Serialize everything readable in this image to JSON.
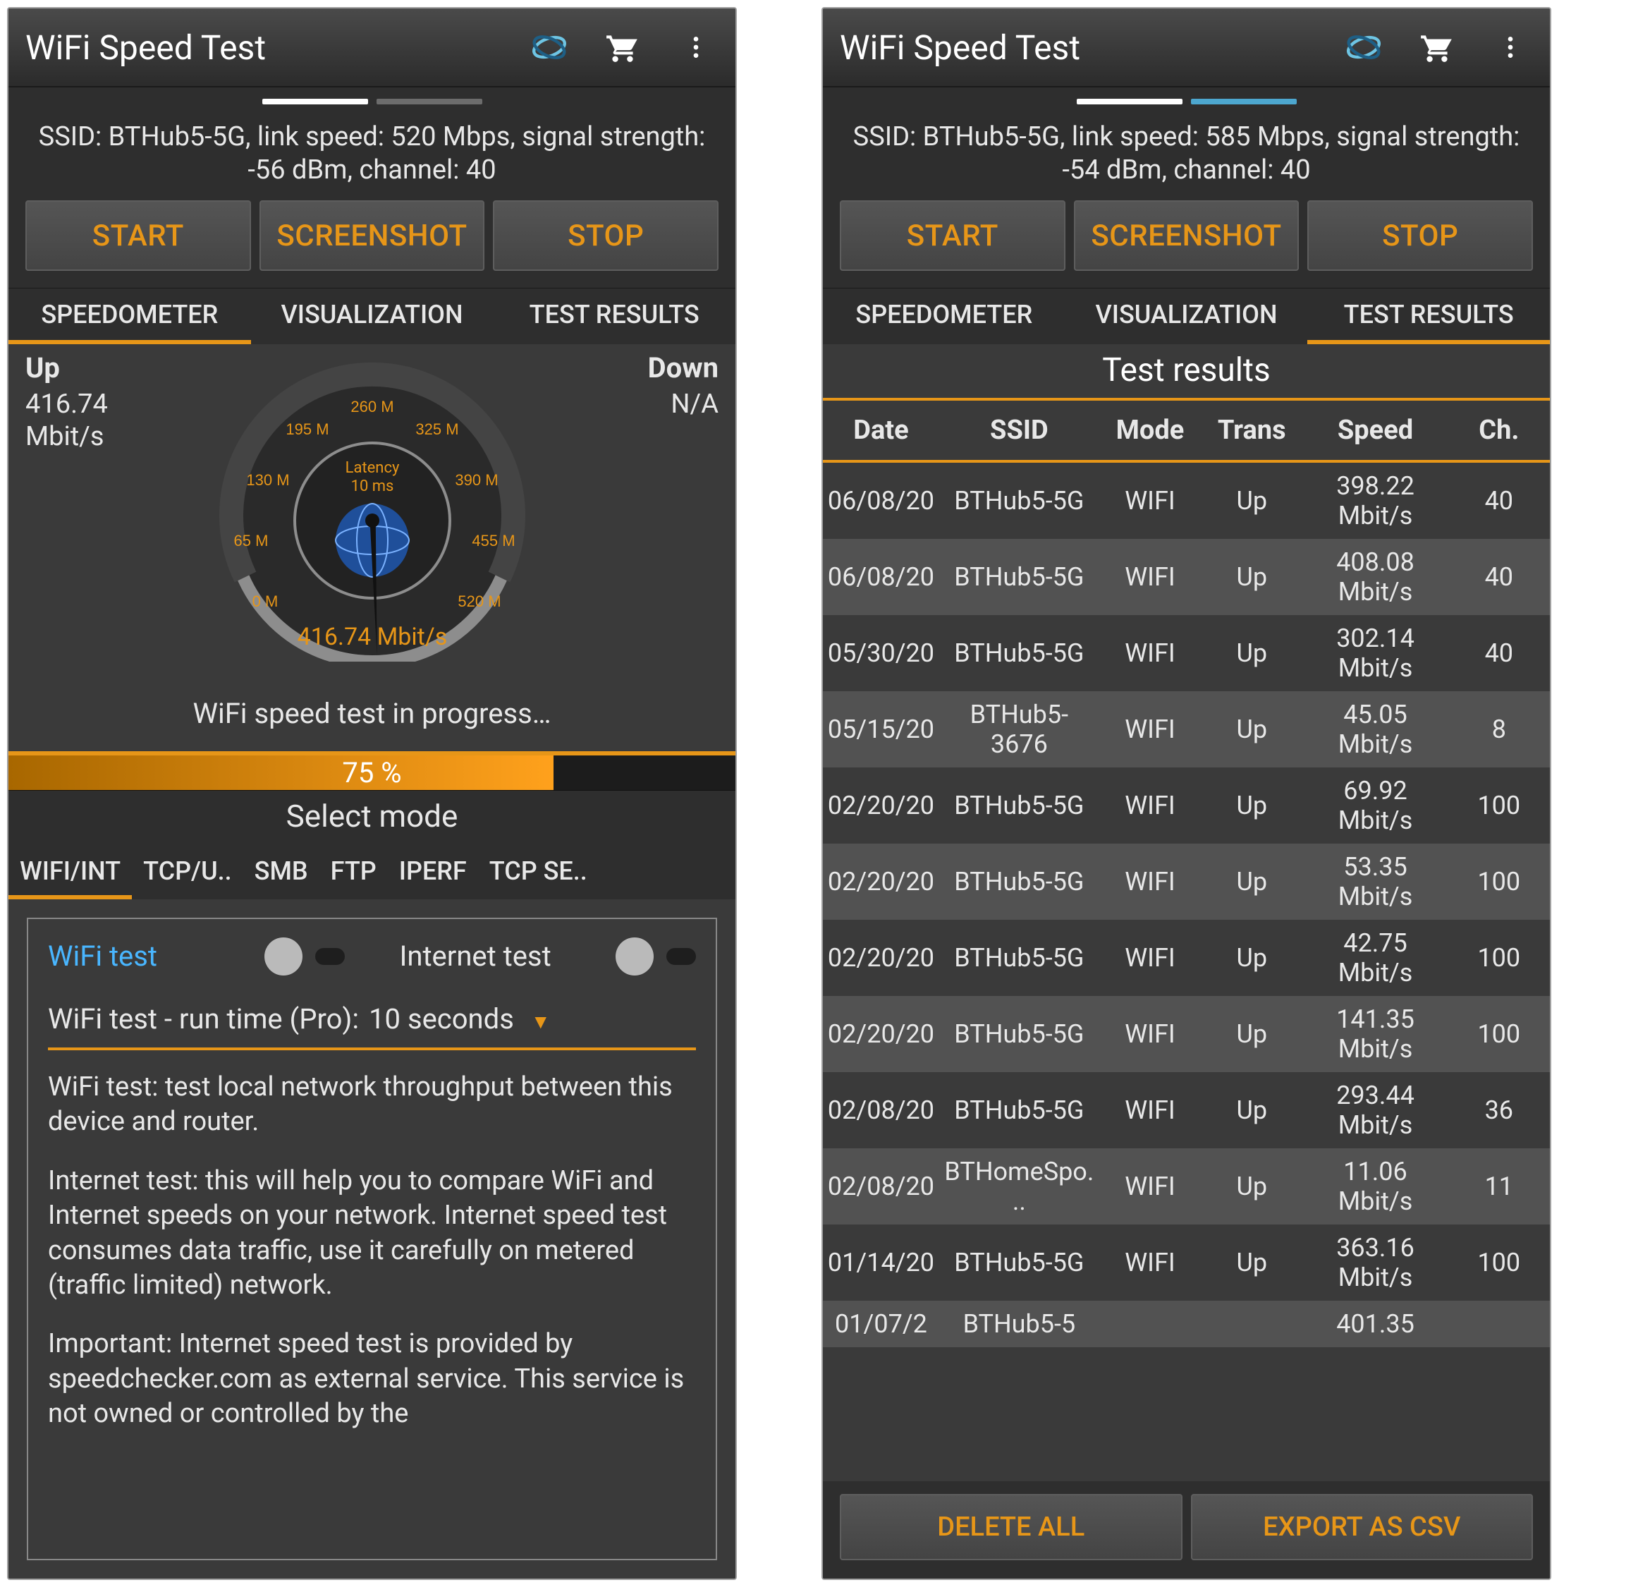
{
  "left": {
    "appbar": {
      "title": "WiFi Speed Test"
    },
    "ssid_line": "SSID: BTHub5-5G, link speed: 520 Mbps, signal strength: -56 dBm, channel: 40",
    "buttons": {
      "start": "START",
      "screenshot": "SCREENSHOT",
      "stop": "STOP"
    },
    "tabs": [
      "SPEEDOMETER",
      "VISUALIZATION",
      "TEST RESULTS"
    ],
    "active_tab": 0,
    "upload": {
      "label": "Up",
      "value": "416.74",
      "unit": "Mbit/s"
    },
    "download": {
      "label": "Down",
      "value": "N/A",
      "unit": ""
    },
    "gauge": {
      "latency_label": "Latency",
      "latency_value": "10 ms",
      "reading": "416.74 Mbit/s",
      "ticks": [
        "0 M",
        "65 M",
        "130 M",
        "195 M",
        "260 M",
        "325 M",
        "390 M",
        "455 M",
        "520 M"
      ]
    },
    "status_msg": "WiFi speed test in progress…",
    "progress_pct": "75 %",
    "select_mode": "Select mode",
    "subtabs": [
      "WIFI/INT",
      "TCP/U..",
      "SMB",
      "FTP",
      "IPERF",
      "TCP SE.."
    ],
    "active_subtab": 0,
    "wifi_panel": {
      "wifi_label": "WiFi test",
      "internet_label": "Internet test",
      "runtime_label": "WiFi test - run time (Pro):",
      "runtime_value": "10 seconds",
      "para1": "WiFi test: test local network throughput between this device and router.",
      "para2": "Internet test: this will help you to compare WiFi and Internet speeds on your network. Internet speed test consumes data traffic, use it carefully on metered (traffic limited) network.",
      "para3": "Important: Internet speed test is provided by speedchecker.com as external service. This service is not owned or controlled by the"
    }
  },
  "right": {
    "appbar": {
      "title": "WiFi Speed Test"
    },
    "ssid_line": "SSID: BTHub5-5G, link speed: 585 Mbps, signal strength: -54 dBm, channel: 40",
    "buttons": {
      "start": "START",
      "screenshot": "SCREENSHOT",
      "stop": "STOP"
    },
    "tabs": [
      "SPEEDOMETER",
      "VISUALIZATION",
      "TEST RESULTS"
    ],
    "active_tab": 2,
    "results_title": "Test results",
    "columns": [
      "Date",
      "SSID",
      "Mode",
      "Trans",
      "Speed",
      "Ch."
    ],
    "rows": [
      {
        "date": "06/08/20",
        "ssid": "BTHub5-5G",
        "mode": "WIFI",
        "trans": "Up",
        "speed": "398.22 Mbit/s",
        "ch": "40"
      },
      {
        "date": "06/08/20",
        "ssid": "BTHub5-5G",
        "mode": "WIFI",
        "trans": "Up",
        "speed": "408.08 Mbit/s",
        "ch": "40"
      },
      {
        "date": "05/30/20",
        "ssid": "BTHub5-5G",
        "mode": "WIFI",
        "trans": "Up",
        "speed": "302.14 Mbit/s",
        "ch": "40"
      },
      {
        "date": "05/15/20",
        "ssid": "BTHub5-3676",
        "mode": "WIFI",
        "trans": "Up",
        "speed": "45.05 Mbit/s",
        "ch": "8"
      },
      {
        "date": "02/20/20",
        "ssid": "BTHub5-5G",
        "mode": "WIFI",
        "trans": "Up",
        "speed": "69.92 Mbit/s",
        "ch": "100"
      },
      {
        "date": "02/20/20",
        "ssid": "BTHub5-5G",
        "mode": "WIFI",
        "trans": "Up",
        "speed": "53.35 Mbit/s",
        "ch": "100"
      },
      {
        "date": "02/20/20",
        "ssid": "BTHub5-5G",
        "mode": "WIFI",
        "trans": "Up",
        "speed": "42.75 Mbit/s",
        "ch": "100"
      },
      {
        "date": "02/20/20",
        "ssid": "BTHub5-5G",
        "mode": "WIFI",
        "trans": "Up",
        "speed": "141.35 Mbit/s",
        "ch": "100"
      },
      {
        "date": "02/08/20",
        "ssid": "BTHub5-5G",
        "mode": "WIFI",
        "trans": "Up",
        "speed": "293.44 Mbit/s",
        "ch": "36"
      },
      {
        "date": "02/08/20",
        "ssid": "BTHomeSpo...",
        "mode": "WIFI",
        "trans": "Up",
        "speed": "11.06 Mbit/s",
        "ch": "11"
      },
      {
        "date": "01/14/20",
        "ssid": "BTHub5-5G",
        "mode": "WIFI",
        "trans": "Up",
        "speed": "363.16 Mbit/s",
        "ch": "100"
      },
      {
        "date": "01/07/2",
        "ssid": "BTHub5-5",
        "mode": "",
        "trans": "",
        "speed": "401.35",
        "ch": ""
      }
    ],
    "result_buttons": {
      "delete_all": "DELETE ALL",
      "export_csv": "EXPORT AS CSV"
    }
  }
}
